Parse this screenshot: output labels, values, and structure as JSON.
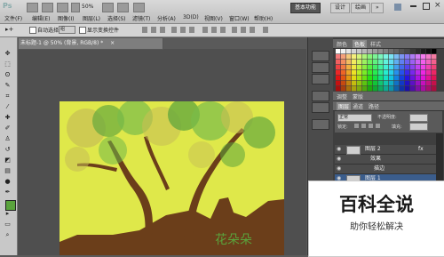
{
  "app": {
    "logo": "Ps",
    "zoom": "50%"
  },
  "menu": [
    "文件(F)",
    "编辑(E)",
    "图像(I)",
    "图层(L)",
    "选择(S)",
    "滤镜(T)",
    "分析(A)",
    "3D(D)",
    "视图(V)",
    "窗口(W)",
    "帮助(H)"
  ],
  "workspaces": {
    "active": "基本功能",
    "items": [
      "设计",
      "绘画",
      "»"
    ]
  },
  "options": {
    "auto_select_label": "自动选择:",
    "auto_select_value": "组",
    "show_transform_label": "显示变换控件"
  },
  "document": {
    "tab_title": "未标题-1 @ 50% (背景, RGB/8) *",
    "tab_close": "×"
  },
  "panels": {
    "top_tabs": [
      "颜色",
      "色板",
      "样式"
    ],
    "top_active": 1,
    "mid_tabs": [
      "调整",
      "蒙版"
    ],
    "layer_tabs": [
      "图层",
      "通道",
      "路径"
    ],
    "layer_active": 0,
    "blend_mode": "正常",
    "opacity_label": "不透明度:",
    "lock_label": "锁定:",
    "fill_label": "填充:"
  },
  "layers": [
    {
      "name": "图层 2",
      "fx": "fx"
    },
    {
      "name": "效果"
    },
    {
      "name": "描边"
    },
    {
      "name": "图层 1"
    }
  ],
  "watermark": {
    "title": "百科全说",
    "subtitle": "助你轻松解决"
  },
  "signature": "花朵朵",
  "colors": {
    "foreground": "#5aa33c",
    "background": "#ffffff",
    "sky": "#dfe84a",
    "ground": "#6b3e1a"
  }
}
